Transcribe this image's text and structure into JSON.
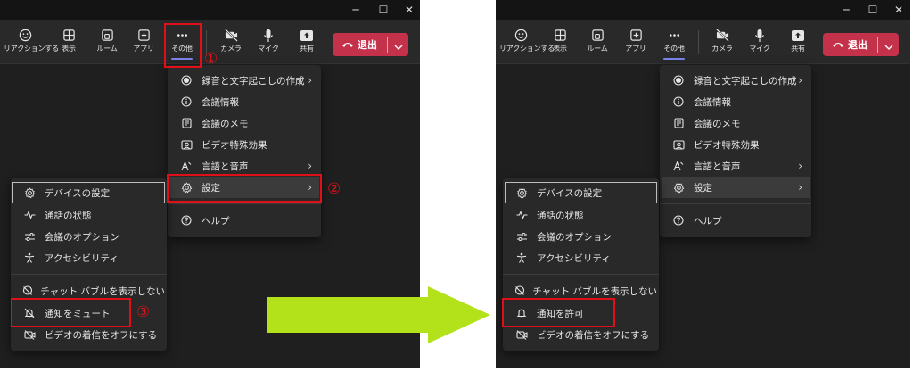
{
  "window_controls": {
    "minimize": "─",
    "maximize": "☐",
    "close": "✕"
  },
  "toolbar": {
    "buttons": [
      {
        "label": "リアクションする",
        "icon": "smiley-icon"
      },
      {
        "label": "表示",
        "icon": "grid-icon"
      },
      {
        "label": "ルーム",
        "icon": "breakout-room-icon"
      },
      {
        "label": "アプリ",
        "icon": "add-app-icon"
      },
      {
        "label": "その他",
        "icon": "more-dots-icon"
      },
      {
        "label": "カメラ",
        "icon": "camera-off-icon"
      },
      {
        "label": "マイク",
        "icon": "microphone-icon"
      },
      {
        "label": "共有",
        "icon": "share-tray-icon"
      }
    ],
    "leave_label": "退出"
  },
  "more_menu": {
    "items": [
      {
        "label": "録音と文字起こしの作成",
        "icon": "record-icon",
        "submenu": true
      },
      {
        "label": "会議情報",
        "icon": "info-icon",
        "submenu": false
      },
      {
        "label": "会議のメモ",
        "icon": "notes-icon",
        "submenu": false
      },
      {
        "label": "ビデオ特殊効果",
        "icon": "video-effects-icon",
        "submenu": false
      },
      {
        "label": "言語と音声",
        "icon": "language-icon",
        "submenu": true
      },
      {
        "label": "設定",
        "icon": "gear-icon",
        "submenu": true
      },
      {
        "label": "ヘルプ",
        "icon": "help-icon",
        "submenu": false
      }
    ]
  },
  "settings_menu": {
    "items": [
      {
        "label": "デバイスの設定",
        "icon": "gear-icon"
      },
      {
        "label": "通話の状態",
        "icon": "pulse-icon"
      },
      {
        "label": "会議のオプション",
        "icon": "options-sliders-icon"
      },
      {
        "label": "アクセシビリティ",
        "icon": "accessibility-icon"
      },
      {
        "label": "チャット バブルを表示しない",
        "icon": "chat-bubble-off-icon"
      },
      {
        "label": "通知をミュート",
        "icon": "bell-off-icon"
      },
      {
        "label": "ビデオの着信をオフにする",
        "icon": "video-off-icon"
      }
    ],
    "toggled_item": {
      "label": "通知を許可",
      "icon": "bell-icon"
    }
  },
  "annotations": {
    "step1": "①",
    "step2": "②",
    "step3": "③"
  },
  "colors": {
    "leave_button": "#c4314b",
    "callout": "#e0101b",
    "arrow": "#b4e21a",
    "active_underline": "#7b83eb"
  }
}
